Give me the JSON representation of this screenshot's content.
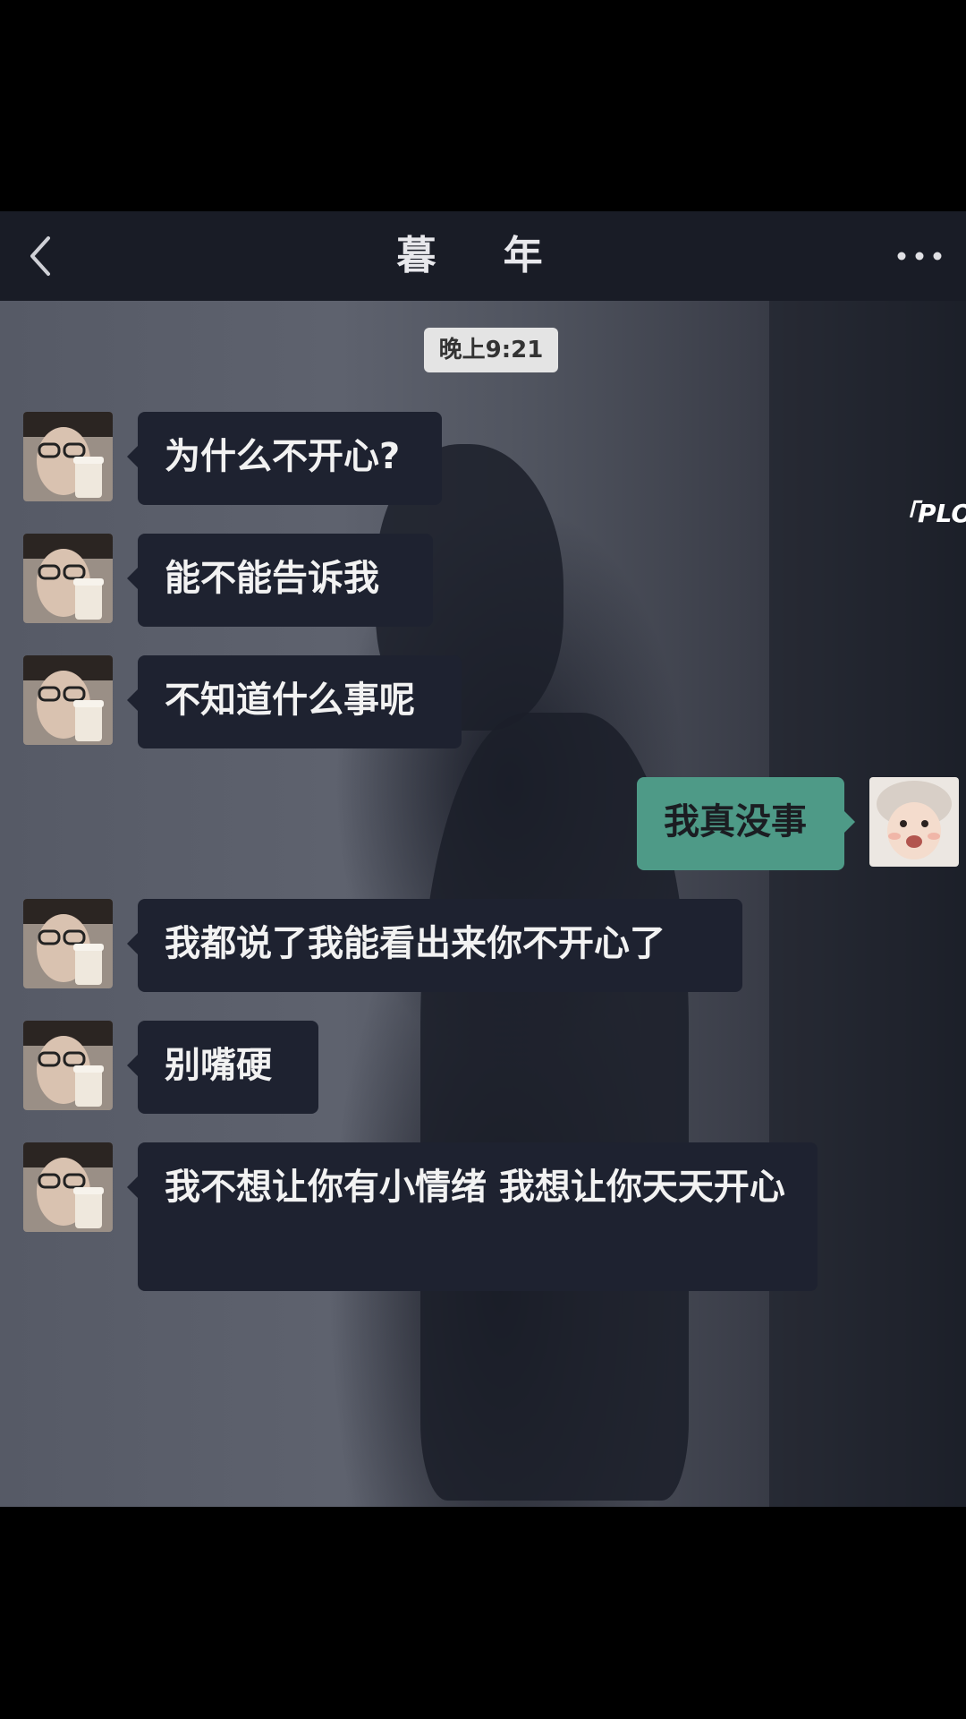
{
  "header": {
    "title": "暮  年",
    "back_icon": "chevron-left-icon",
    "more_icon": "more-dots-icon"
  },
  "chat": {
    "timestamp": "晚上9:21",
    "side_text": "「PLO",
    "messages": [
      {
        "side": "left",
        "text": "为什么不开心?"
      },
      {
        "side": "left",
        "text": "能不能告诉我"
      },
      {
        "side": "left",
        "text": "不知道什么事呢"
      },
      {
        "side": "right",
        "text": "我真没事"
      },
      {
        "side": "left",
        "text": "我都说了我能看出来你不开心了"
      },
      {
        "side": "left",
        "text": "别嘴硬"
      },
      {
        "side": "left",
        "text": "我不想让你有小情绪 我想让你天天开心"
      }
    ]
  },
  "colors": {
    "header_bg": "#191c26",
    "bubble_incoming": "#1e2230",
    "bubble_outgoing": "#4e9a87",
    "timestamp_bg": "#e4e4e4"
  }
}
